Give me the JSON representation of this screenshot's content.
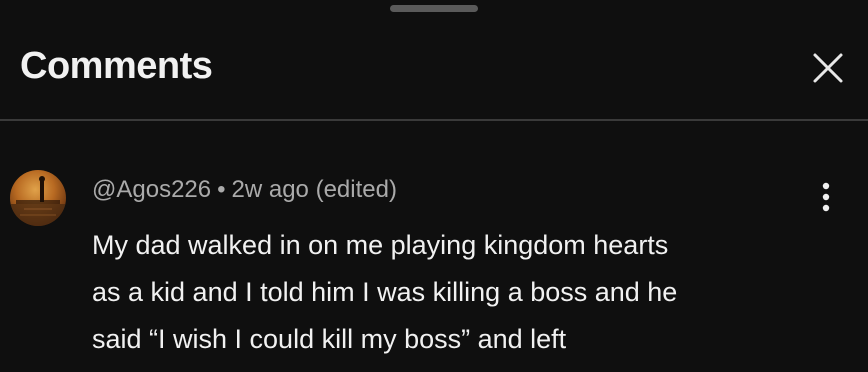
{
  "sheet": {
    "title": "Comments"
  },
  "comment": {
    "author": "@Agos226",
    "separator": "•",
    "time": "2w ago",
    "edited": "(edited)",
    "lines": [
      "My dad walked in on me playing kingdom hearts",
      "as a kid and I told him I was killing a boss and he",
      "said “I wish I could kill my boss” and left"
    ]
  },
  "icons": {
    "close": "close-icon",
    "more": "more-vert-icon",
    "avatar": "avatar-image"
  },
  "colors": {
    "background": "#0f0f0f",
    "text_primary": "#f1f1f1",
    "text_secondary": "#aaaaaa",
    "divider": "#3a3a3a"
  }
}
